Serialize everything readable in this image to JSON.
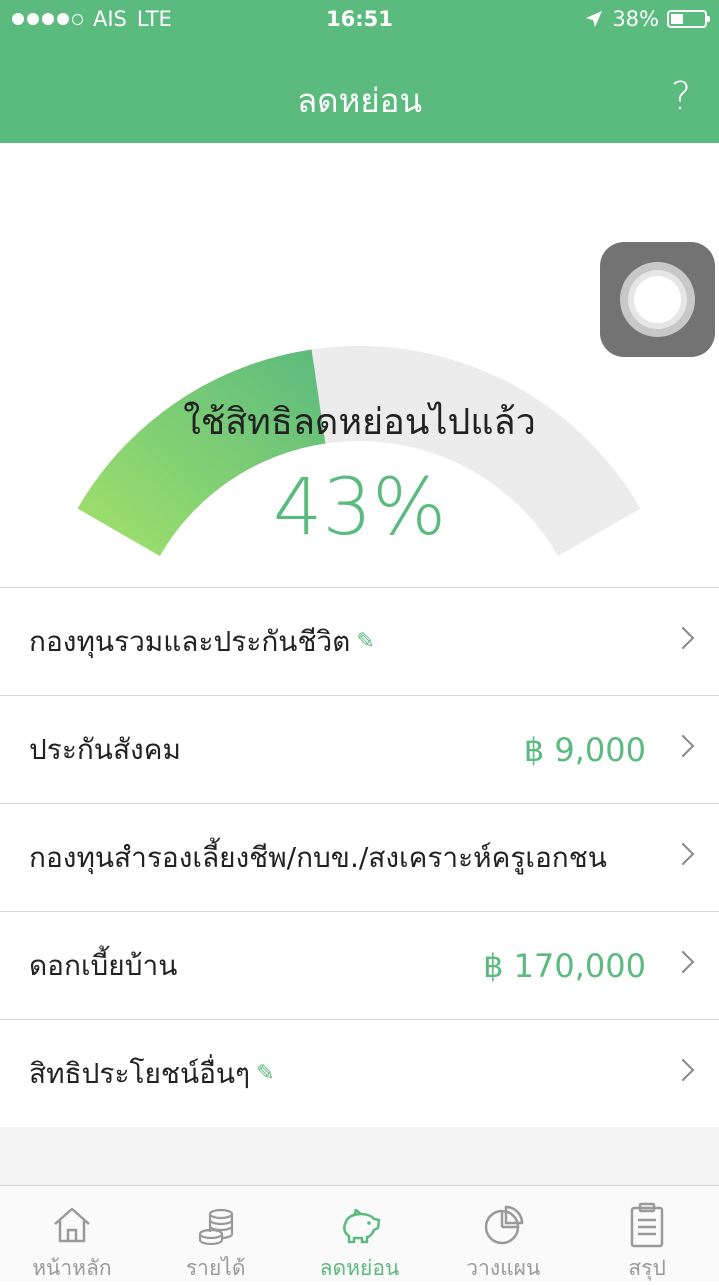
{
  "status_bar": {
    "carrier": "AIS",
    "network": "LTE",
    "time": "16:51",
    "battery": "38%",
    "battery_fraction": 0.38
  },
  "header": {
    "title": "ลดหย่อน",
    "help_icon": "?"
  },
  "gauge": {
    "label": "ใช้สิทธิลดหย่อนไปแล้ว",
    "value_text": "43%",
    "fraction": 0.43,
    "fill_color": "#5bba7e",
    "fill_color_light": "#a3e26a",
    "track_color": "#ececec"
  },
  "items": [
    {
      "label": "กองทุนรวมและประกันชีวิต",
      "value": "",
      "editable": true
    },
    {
      "label": "ประกันสังคม",
      "value": "฿ 9,000",
      "editable": false
    },
    {
      "label": "กองทุนสำรองเลี้ยงชีพ/กบข./สงเคราะห์ครูเอกชน",
      "value": "",
      "editable": false
    },
    {
      "label": "ดอกเบี้ยบ้าน",
      "value": "฿ 170,000",
      "editable": false
    },
    {
      "label": "สิทธิประโยชน์อื่นๆ",
      "value": "",
      "editable": true
    }
  ],
  "tabs": [
    {
      "label": "หน้าหลัก",
      "icon": "home-icon",
      "active": false
    },
    {
      "label": "รายได้",
      "icon": "coins-icon",
      "active": false
    },
    {
      "label": "ลดหย่อน",
      "icon": "piggy-bank-icon",
      "active": true
    },
    {
      "label": "วางแผน",
      "icon": "pie-chart-icon",
      "active": false
    },
    {
      "label": "สรุป",
      "icon": "clipboard-icon",
      "active": false
    }
  ]
}
